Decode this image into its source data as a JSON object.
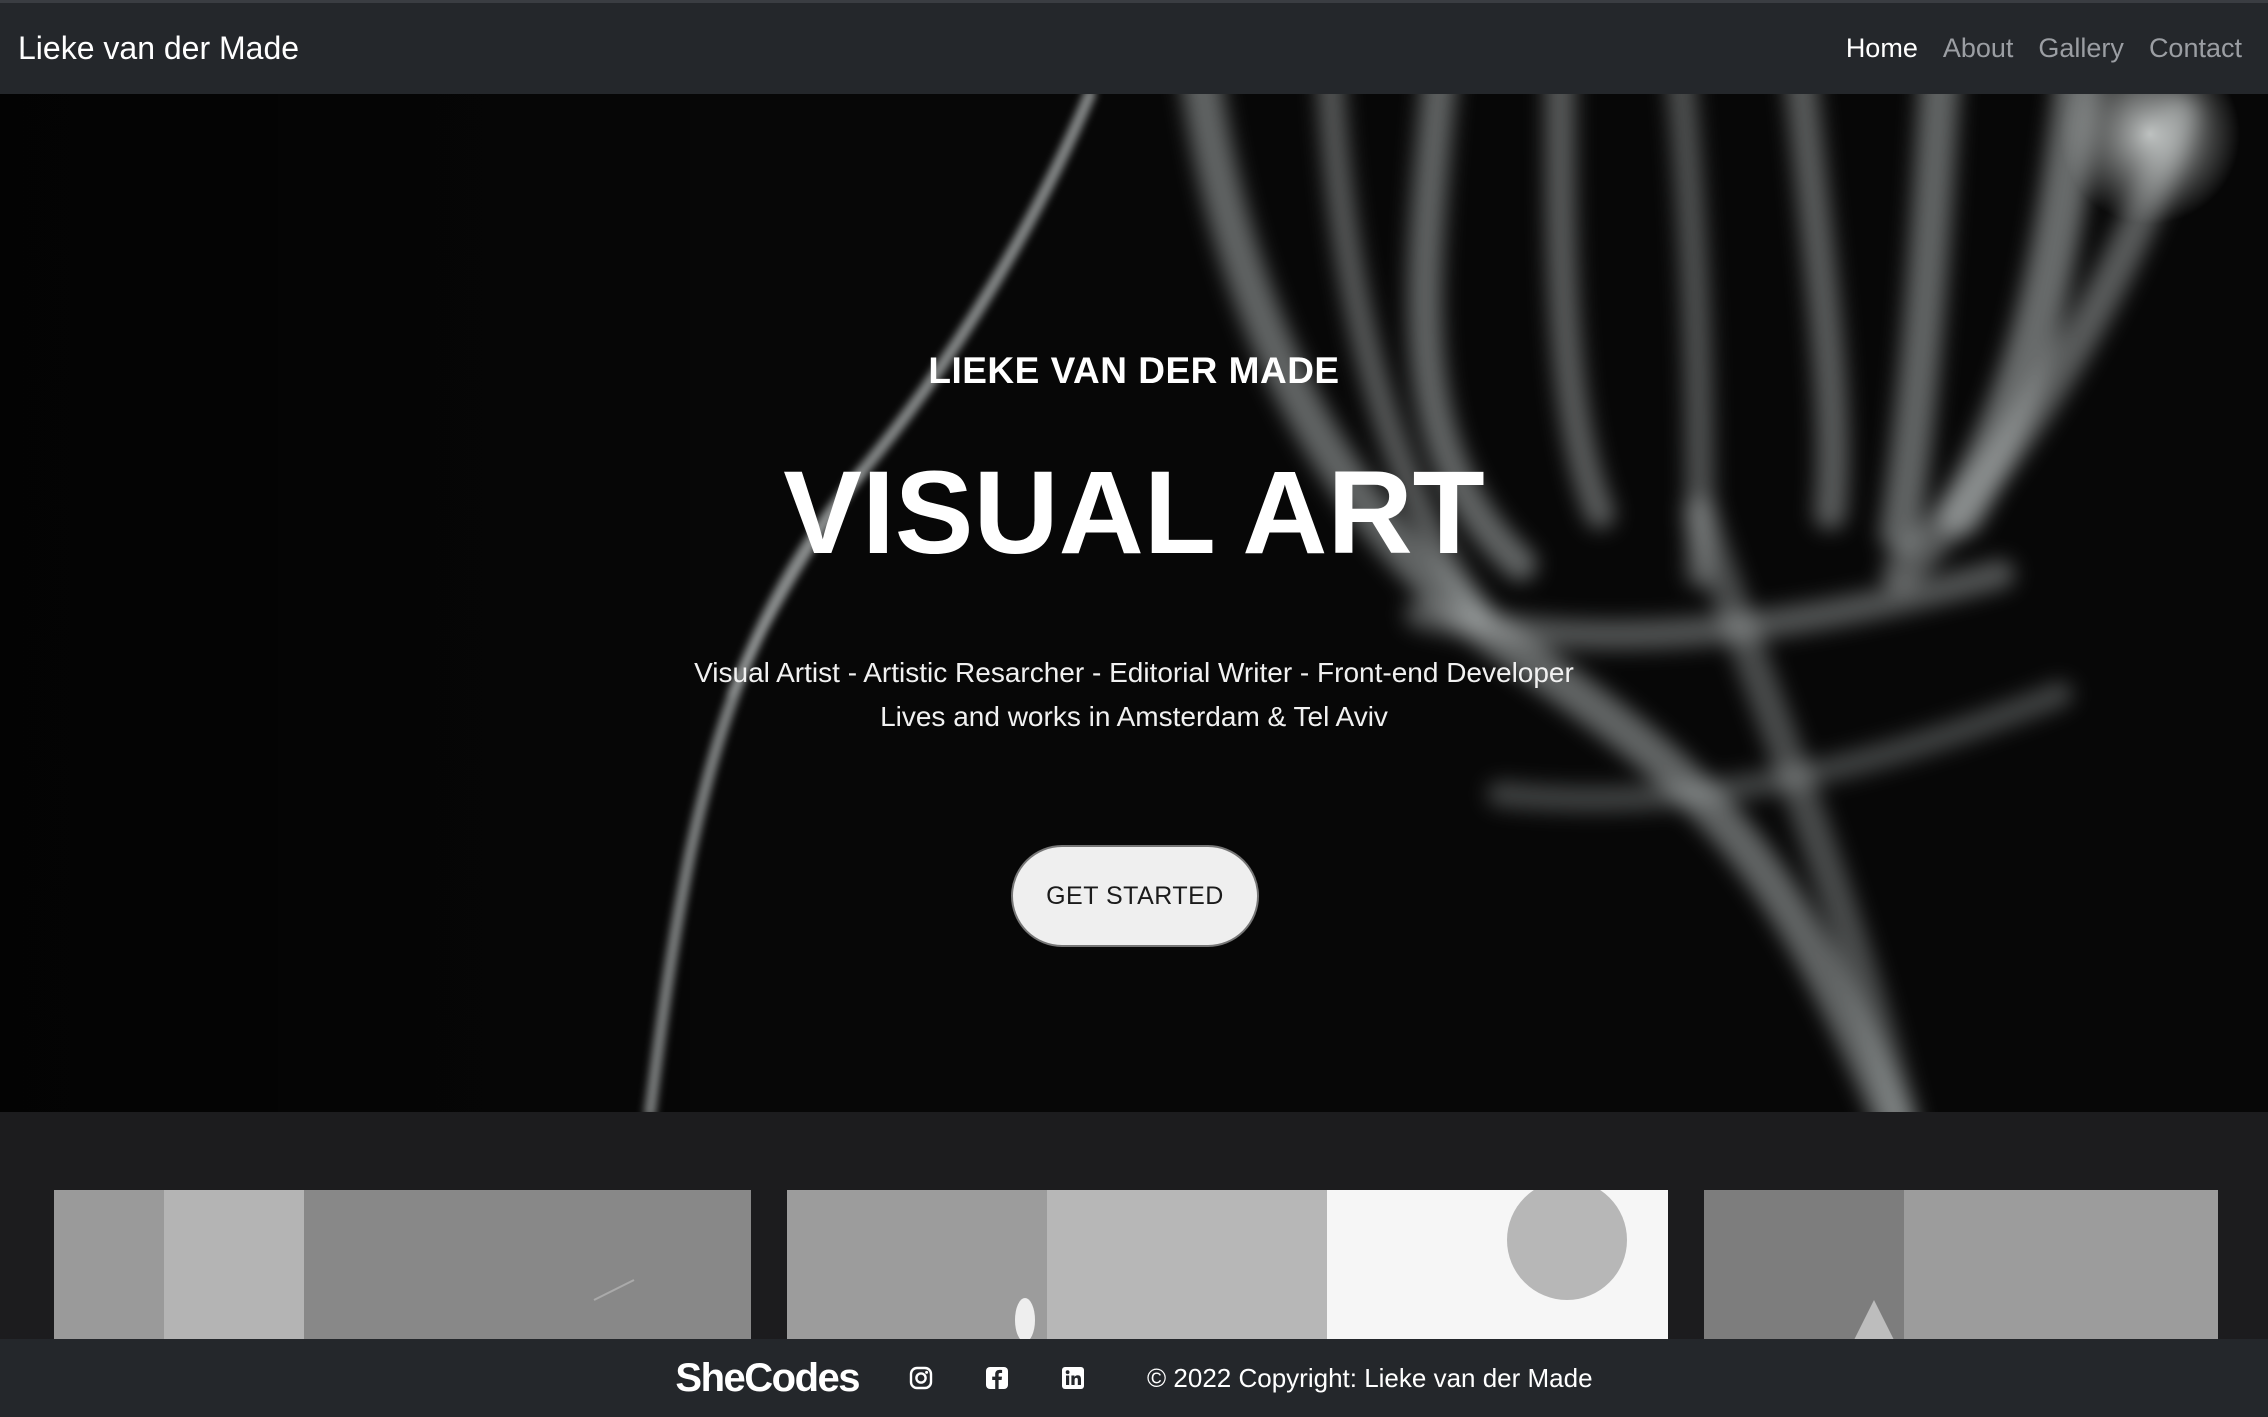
{
  "nav": {
    "brand": "Lieke van der Made",
    "links": [
      {
        "label": "Home",
        "active": true
      },
      {
        "label": "About",
        "active": false
      },
      {
        "label": "Gallery",
        "active": false
      },
      {
        "label": "Contact",
        "active": false
      }
    ]
  },
  "hero": {
    "kicker": "LIEKE VAN DER MADE",
    "title": "VISUAL ART",
    "subtitle_line1": "Visual Artist - Artistic Resarcher - Editorial Writer - Front-end Developer",
    "subtitle_line2": "Lives and works in Amsterdam & Tel Aviv",
    "button_label": "GET STARTED"
  },
  "footer": {
    "logo": "SheCodes",
    "icons": [
      "instagram-icon",
      "facebook-icon",
      "linkedin-icon"
    ],
    "copyright": "© 2022 Copyright: Lieke van der Made"
  },
  "colors": {
    "navbar_bg": "#24272b",
    "page_bg": "#1c1c1e",
    "nav_active": "#ffffff",
    "nav_inactive": "#9b9ea3",
    "button_bg": "#efefef"
  }
}
